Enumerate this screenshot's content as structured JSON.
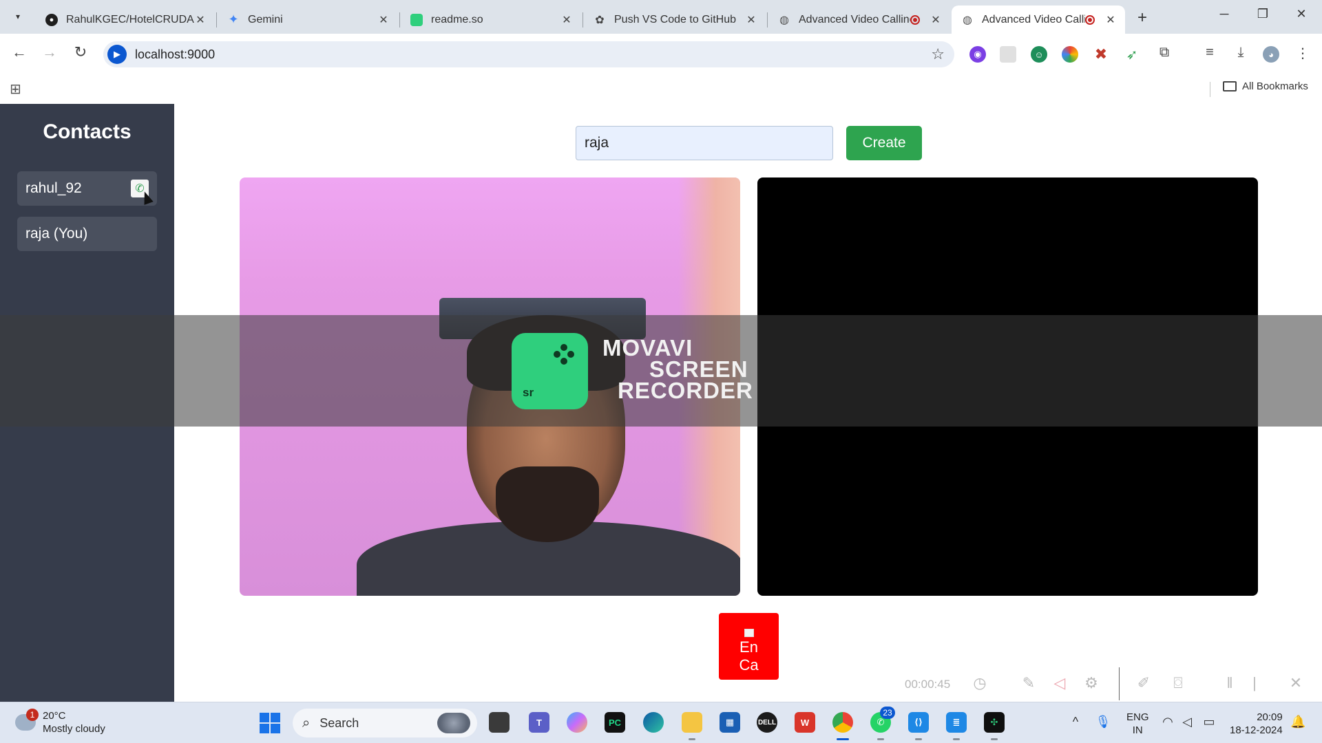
{
  "browser": {
    "tabs": [
      {
        "title": "RahulKGEC/HotelCRUDApp",
        "favicon": "github-icon",
        "active": false,
        "recording": false
      },
      {
        "title": "Gemini",
        "favicon": "gemini-icon",
        "active": false,
        "recording": false
      },
      {
        "title": "readme.so",
        "favicon": "readme-icon",
        "active": false,
        "recording": false
      },
      {
        "title": "Push VS Code to GitHub",
        "favicon": "openai-icon",
        "active": false,
        "recording": false
      },
      {
        "title": "Advanced Video Calling",
        "favicon": "globe-icon",
        "active": false,
        "recording": true
      },
      {
        "title": "Advanced Video Calling",
        "favicon": "globe-icon",
        "active": true,
        "recording": true
      }
    ],
    "address": "localhost:9000",
    "bookmarks_label": "All Bookmarks"
  },
  "page": {
    "contacts_heading": "Contacts",
    "contacts": [
      {
        "name": "rahul_92",
        "has_call_button": true
      },
      {
        "name": "raja (You)",
        "has_call_button": false
      }
    ],
    "name_input_value": "raja",
    "create_label": "Create",
    "end_call_alt_line1": "En",
    "end_call_alt_line2": "Ca"
  },
  "watermark": {
    "badge": "sr",
    "line1": "MOVAVI",
    "line2": "SCREEN",
    "line3": "RECORDER"
  },
  "recorder": {
    "elapsed": "00:00:45"
  },
  "taskbar": {
    "weather_temp": "20°C",
    "weather_desc": "Mostly cloudy",
    "weather_badge": "1",
    "search_label": "Search",
    "whatsapp_badge": "23",
    "lang_line1": "ENG",
    "lang_line2": "IN",
    "time": "20:09",
    "date": "18-12-2024"
  },
  "colors": {
    "sidebar_bg": "#363c4b",
    "contact_bg": "#4a505e",
    "create_button": "#2ea44f",
    "end_call_button": "#ff0000",
    "input_bg": "#e8f0fe",
    "accent_blue": "#0b57d0"
  }
}
